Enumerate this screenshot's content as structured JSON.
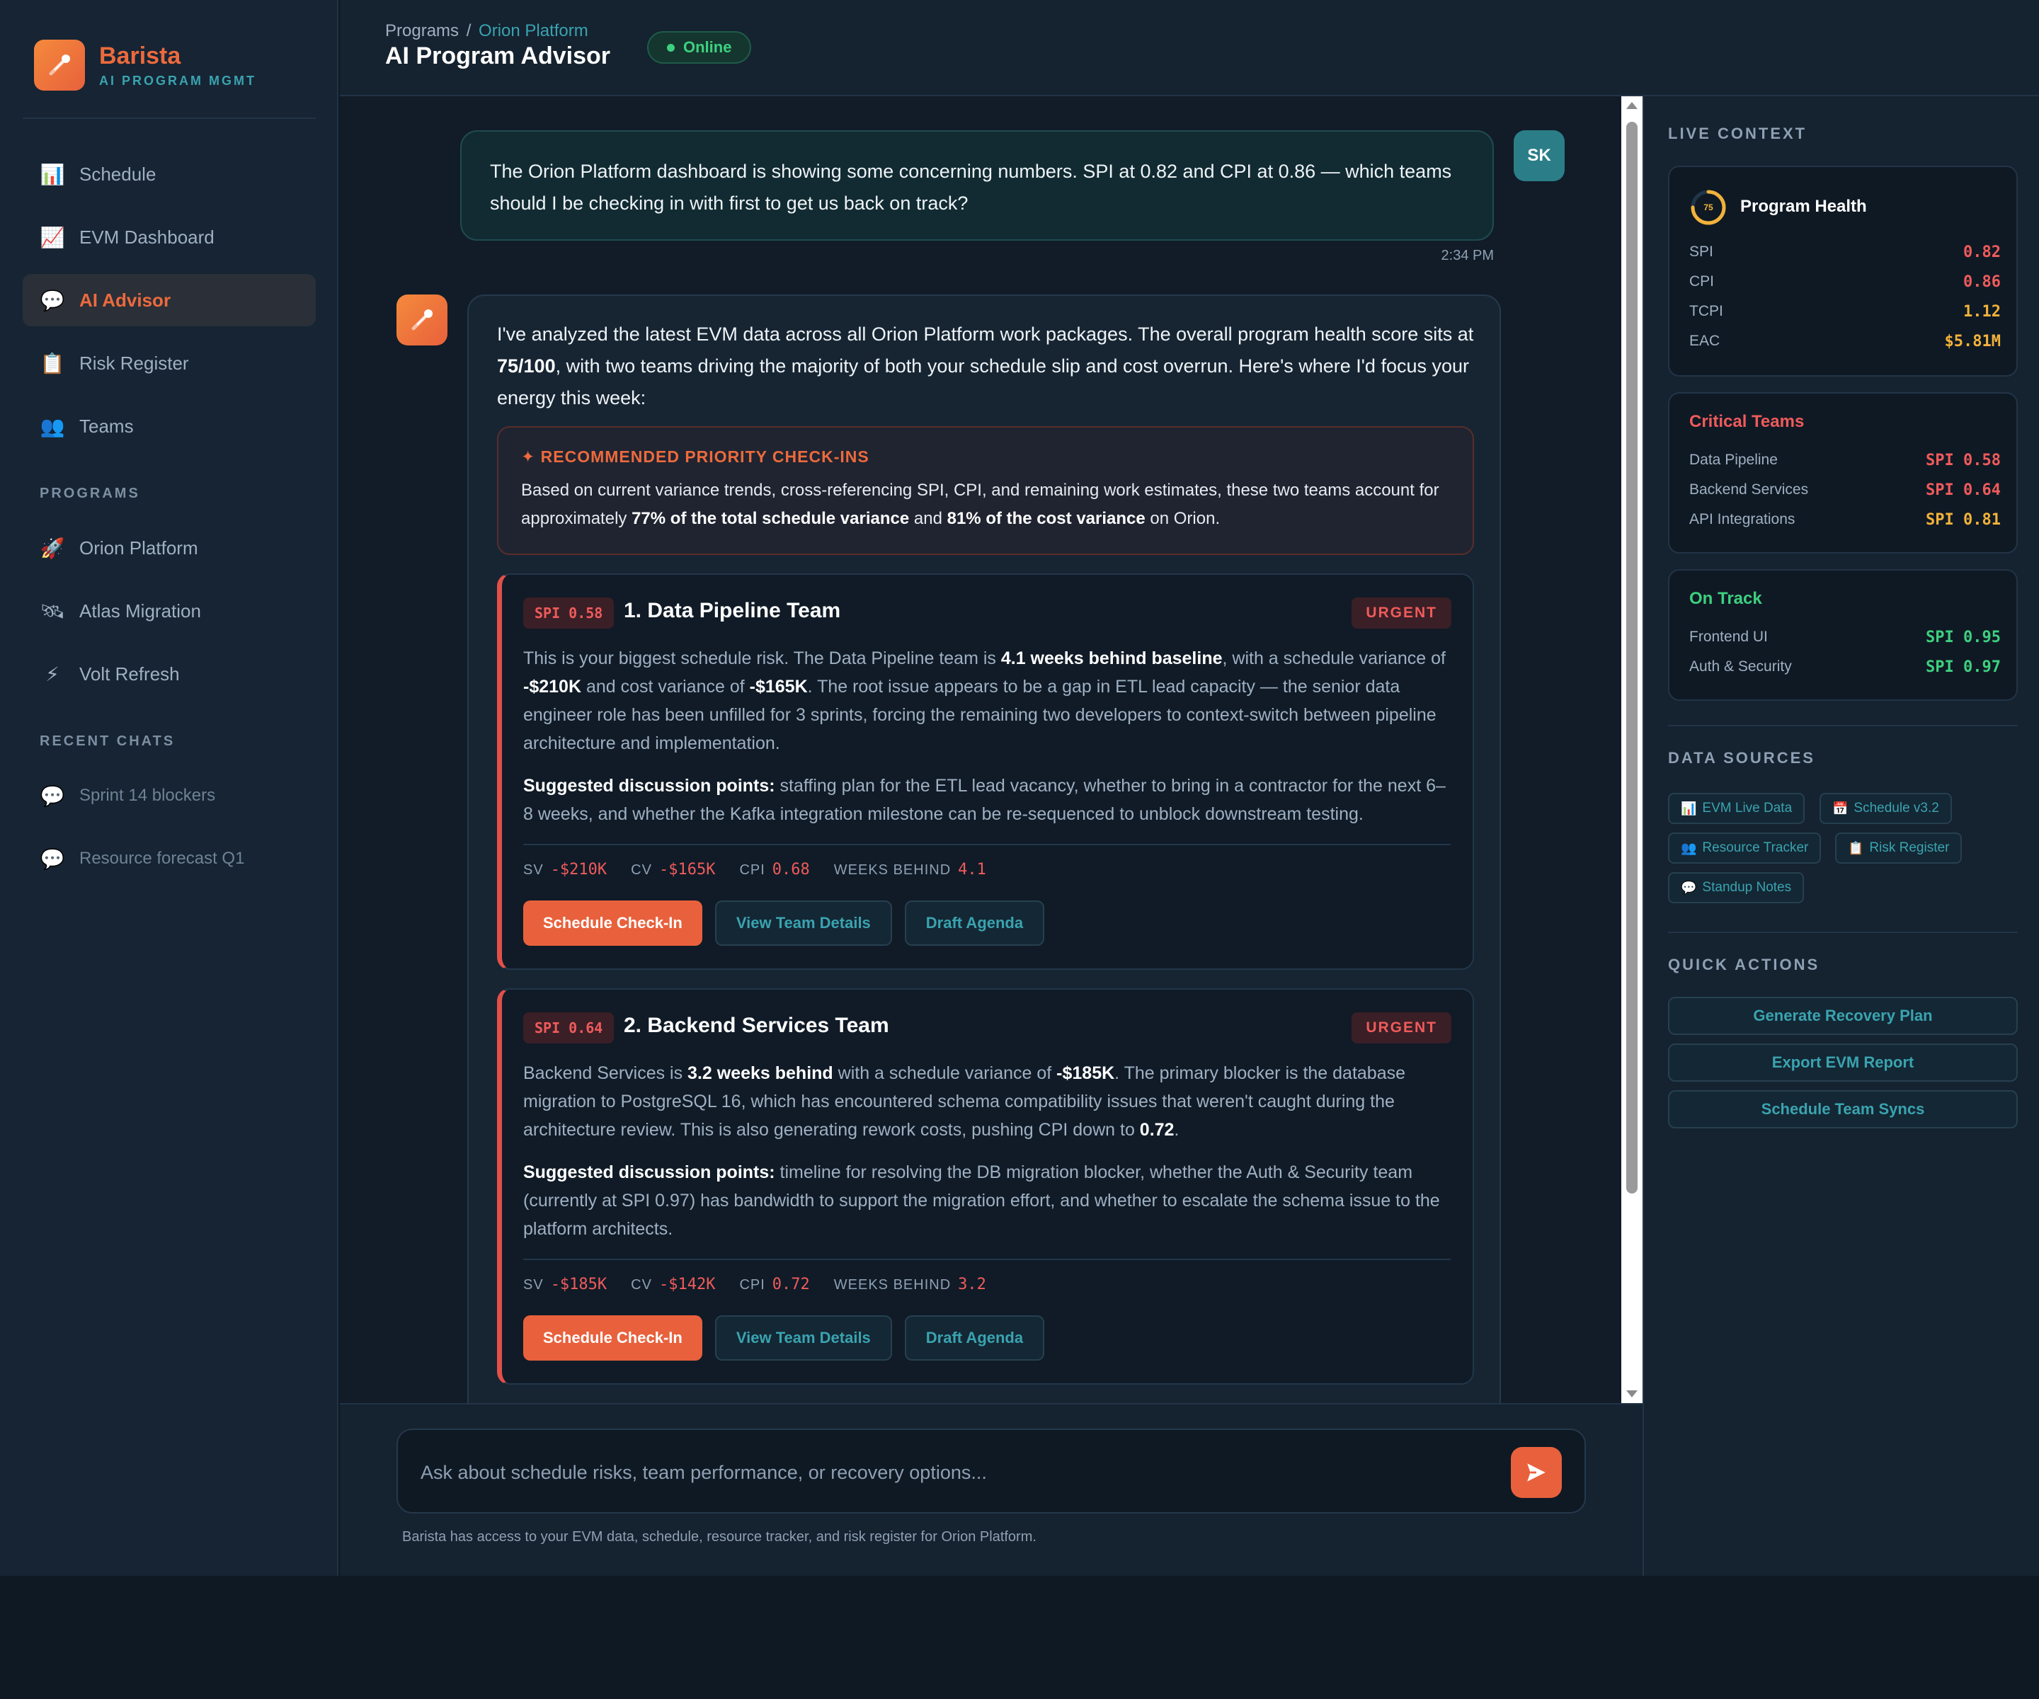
{
  "brand": {
    "name": "Barista",
    "subtitle": "AI PROGRAM MGMT"
  },
  "sidebar": {
    "nav": [
      {
        "label": "Schedule",
        "icon": "📊"
      },
      {
        "label": "EVM Dashboard",
        "icon": "📈"
      },
      {
        "label": "AI Advisor",
        "icon": "💬"
      },
      {
        "label": "Risk Register",
        "icon": "📋"
      },
      {
        "label": "Teams",
        "icon": "👥"
      }
    ],
    "programs_heading": "PROGRAMS",
    "programs": [
      {
        "label": "Orion Platform",
        "icon": "🚀"
      },
      {
        "label": "Atlas Migration",
        "icon": "🛰"
      },
      {
        "label": "Volt Refresh",
        "icon": "⚡"
      }
    ],
    "recent_heading": "RECENT CHATS",
    "recent": [
      {
        "label": "Sprint 14 blockers",
        "icon": "💬"
      },
      {
        "label": "Resource forecast Q1",
        "icon": "💬"
      }
    ]
  },
  "header": {
    "crumb_root": "Programs",
    "crumb_sep": "/",
    "crumb_current": "Orion Platform",
    "title": "AI Program Advisor",
    "status": "Online"
  },
  "chat": {
    "user_initials": "SK",
    "user_message": "The Orion Platform dashboard is showing some concerning numbers. SPI at 0.82 and CPI at 0.86 — which teams should I be checking in with first to get us back on track?",
    "user_time": "2:34 PM",
    "ai_intro": {
      "p1": "I've analyzed the latest EVM data across all Orion Platform work packages. The overall program health score sits at ",
      "b1": "75/100",
      "p2": ", with two teams driving the majority of both your schedule slip and cost overrun. Here's where I'd focus your energy this week:"
    },
    "recommendation": {
      "title": "✦ RECOMMENDED PRIORITY CHECK-INS",
      "p1": "Based on current variance trends, cross-referencing SPI, CPI, and remaining work estimates, these two teams account for approximately ",
      "b1": "77% of the total schedule variance",
      "p2": " and ",
      "b2": "81% of the cost variance",
      "p3": " on Orion."
    },
    "teams": [
      {
        "badge": "SPI 0.58",
        "title": "1. Data Pipeline Team",
        "urgency": "URGENT",
        "desc": {
          "p1": "This is your biggest schedule risk. The Data Pipeline team is ",
          "b1": "4.1 weeks behind baseline",
          "p2": ", with a schedule variance of ",
          "b2": "-$210K",
          "p3": " and cost variance of ",
          "b3": "-$165K",
          "p4": ". The root issue appears to be a gap in ETL lead capacity — the senior data engineer role has been unfilled for 3 sprints, forcing the remaining two developers to context-switch between pipeline architecture and implementation."
        },
        "points_label": "Suggested discussion points:",
        "points": " staffing plan for the ETL lead vacancy, whether to bring in a contractor for the next 6–8 weeks, and whether the Kafka integration milestone can be re-sequenced to unblock downstream testing.",
        "metrics": {
          "sv_label": "SV",
          "sv": "-$210K",
          "cv_label": "CV",
          "cv": "-$165K",
          "cpi_label": "CPI",
          "cpi": "0.68",
          "wb_label": "WEEKS BEHIND",
          "wb": "4.1"
        },
        "buttons": {
          "primary": "Schedule Check-In",
          "details": "View Team Details",
          "agenda": "Draft Agenda"
        }
      },
      {
        "badge": "SPI 0.64",
        "title": "2. Backend Services Team",
        "urgency": "URGENT",
        "desc": {
          "p1": "Backend Services is ",
          "b1": "3.2 weeks behind",
          "p2": " with a schedule variance of ",
          "b2": "-$185K",
          "p3": ". The primary blocker is the database migration to PostgreSQL 16, which has encountered schema compatibility issues that weren't caught during the architecture review. This is also generating rework costs, pushing CPI down to ",
          "b3": "0.72",
          "p4": "."
        },
        "points_label": "Suggested discussion points:",
        "points": " timeline for resolving the DB migration blocker, whether the Auth & Security team (currently at SPI 0.97) has bandwidth to support the migration effort, and whether to escalate the schema issue to the platform architects.",
        "metrics": {
          "sv_label": "SV",
          "sv": "-$185K",
          "cv_label": "CV",
          "cv": "-$142K",
          "cpi_label": "CPI",
          "cpi": "0.72",
          "wb_label": "WEEKS BEHIND",
          "wb": "3.2"
        },
        "buttons": {
          "primary": "Schedule Check-In",
          "details": "View Team Details",
          "agenda": "Draft Agenda"
        }
      }
    ]
  },
  "input": {
    "placeholder": "Ask about schedule risks, team performance, or recovery options...",
    "note": "Barista has access to your EVM data, schedule, resource tracker, and risk register for Orion Platform."
  },
  "right_panel": {
    "live_context_heading": "LIVE CONTEXT",
    "health": {
      "title": "Program Health",
      "score": "75",
      "score_fraction": 0.75,
      "rows": [
        {
          "label": "SPI",
          "value": "0.82"
        },
        {
          "label": "CPI",
          "value": "0.86"
        },
        {
          "label": "TCPI",
          "value": "1.12"
        },
        {
          "label": "EAC",
          "value": "$5.81M"
        }
      ]
    },
    "critical": {
      "title": "Critical Teams",
      "rows": [
        {
          "label": "Data Pipeline",
          "value": "SPI 0.58"
        },
        {
          "label": "Backend Services",
          "value": "SPI 0.64"
        },
        {
          "label": "API Integrations",
          "value": "SPI 0.81"
        }
      ]
    },
    "on_track": {
      "title": "On Track",
      "rows": [
        {
          "label": "Frontend UI",
          "value": "SPI 0.95"
        },
        {
          "label": "Auth & Security",
          "value": "SPI 0.97"
        }
      ]
    },
    "data_sources_heading": "DATA SOURCES",
    "data_sources": [
      {
        "icon": "📊",
        "label": "EVM Live Data"
      },
      {
        "icon": "📅",
        "label": "Schedule v3.2"
      },
      {
        "icon": "👥",
        "label": "Resource Tracker"
      },
      {
        "icon": "📋",
        "label": "Risk Register"
      },
      {
        "icon": "💬",
        "label": "Standup Notes"
      }
    ],
    "quick_actions_heading": "QUICK ACTIONS",
    "quick_actions": [
      "Generate Recovery Plan",
      "Export EVM Report",
      "Schedule Team Syncs"
    ]
  },
  "colors": {
    "accent": "#e8613c",
    "teal": "#3aa3b0",
    "danger": "#ef5b5b",
    "warning": "#f2b23a",
    "success": "#3ed07f"
  }
}
